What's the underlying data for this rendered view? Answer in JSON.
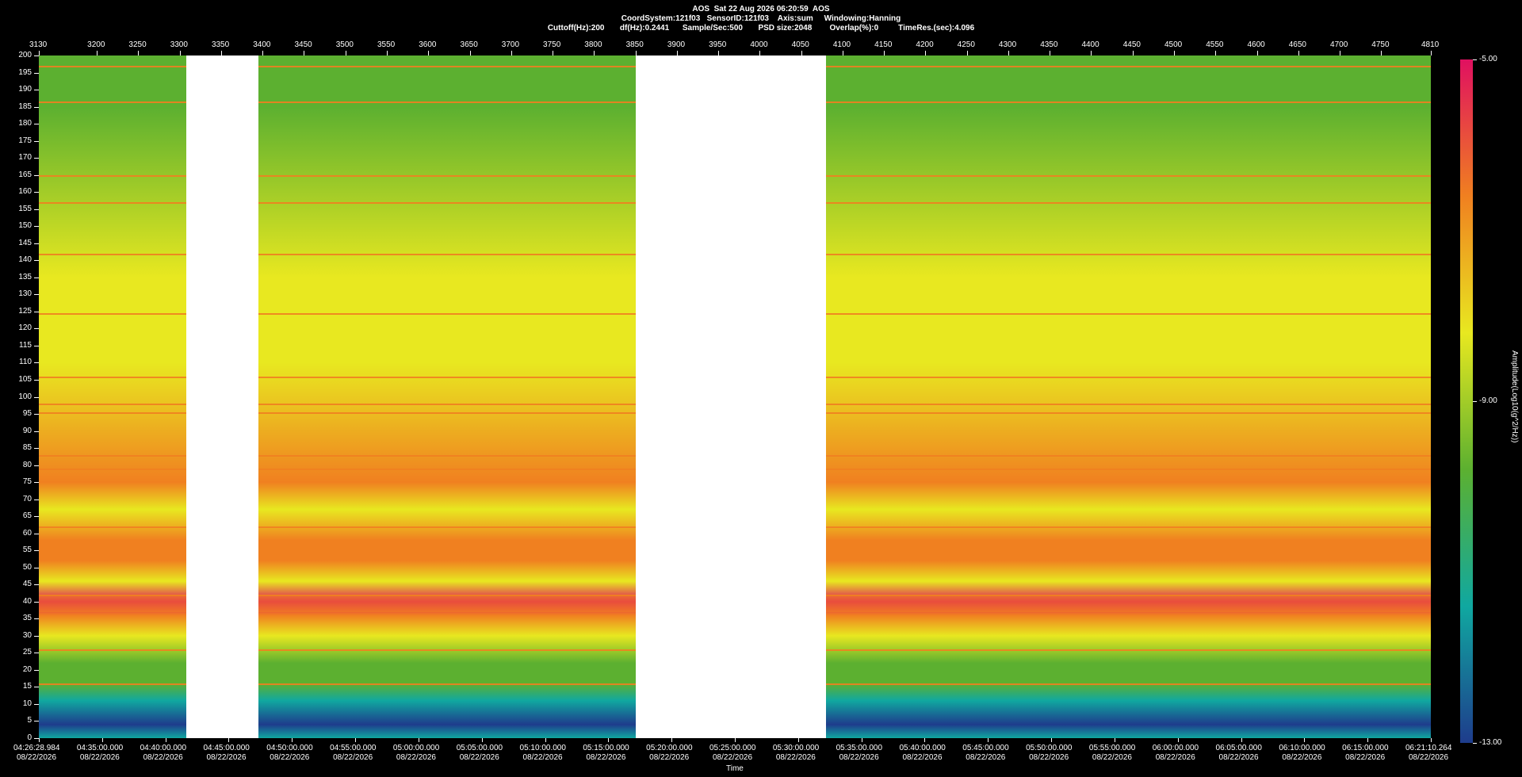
{
  "header": {
    "line1": "AOS  Sat 22 Aug 2026 06:20:59  AOS",
    "line2": "CoordSystem:121f03   SensorID:121f03    Axis:sum     Windowing:Hanning",
    "line3": "Cuttoff(Hz):200       df(Hz):0.2441      Sample/Sec:500       PSD size:2048        Overlap(%):0         TimeRes.(sec):4.096"
  },
  "chart_data": {
    "type": "heatmap",
    "title": "AOS  Sat 22 Aug 2026 06:20:59  AOS",
    "xlabel": "Time",
    "ylabel": "",
    "colorbar_label": "Amplitude(Log10(g^2/Hz))",
    "colorbar_ticks": [
      "-5.00",
      "-9.00",
      "-13.00"
    ],
    "colorbar_range": [
      -13,
      -5
    ],
    "top_axis_ticks": [
      3130,
      3200,
      3250,
      3300,
      3350,
      3400,
      3450,
      3500,
      3550,
      3600,
      3650,
      3700,
      3750,
      3800,
      3850,
      3900,
      3950,
      4000,
      4050,
      4100,
      4150,
      4200,
      4250,
      4300,
      4350,
      4400,
      4450,
      4500,
      4550,
      4600,
      4650,
      4700,
      4750,
      4810
    ],
    "top_axis_range": [
      3130,
      4810
    ],
    "y_ticks": [
      200,
      195,
      190,
      185,
      180,
      175,
      170,
      165,
      160,
      155,
      150,
      145,
      140,
      135,
      130,
      125,
      120,
      115,
      110,
      105,
      100,
      95,
      90,
      85,
      80,
      75,
      70,
      65,
      60,
      55,
      50,
      45,
      40,
      35,
      30,
      25,
      20,
      15,
      10,
      5,
      0
    ],
    "ylim": [
      0,
      200
    ],
    "x_ticks": [
      {
        "time": "04:26:28.984",
        "date": "08/22/2026"
      },
      {
        "time": "04:35:00.000",
        "date": "08/22/2026"
      },
      {
        "time": "04:40:00.000",
        "date": "08/22/2026"
      },
      {
        "time": "04:45:00.000",
        "date": "08/22/2026"
      },
      {
        "time": "04:50:00.000",
        "date": "08/22/2026"
      },
      {
        "time": "04:55:00.000",
        "date": "08/22/2026"
      },
      {
        "time": "05:00:00.000",
        "date": "08/22/2026"
      },
      {
        "time": "05:05:00.000",
        "date": "08/22/2026"
      },
      {
        "time": "05:10:00.000",
        "date": "08/22/2026"
      },
      {
        "time": "05:15:00.000",
        "date": "08/22/2026"
      },
      {
        "time": "05:20:00.000",
        "date": "08/22/2026"
      },
      {
        "time": "05:25:00.000",
        "date": "08/22/2026"
      },
      {
        "time": "05:30:00.000",
        "date": "08/22/2026"
      },
      {
        "time": "05:35:00.000",
        "date": "08/22/2026"
      },
      {
        "time": "05:40:00.000",
        "date": "08/22/2026"
      },
      {
        "time": "05:45:00.000",
        "date": "08/22/2026"
      },
      {
        "time": "05:50:00.000",
        "date": "08/22/2026"
      },
      {
        "time": "05:55:00.000",
        "date": "08/22/2026"
      },
      {
        "time": "06:00:00.000",
        "date": "08/22/2026"
      },
      {
        "time": "06:05:00.000",
        "date": "08/22/2026"
      },
      {
        "time": "06:10:00.000",
        "date": "08/22/2026"
      },
      {
        "time": "06:15:00.000",
        "date": "08/22/2026"
      },
      {
        "time": "06:21:10.264",
        "date": "08/22/2026"
      }
    ],
    "data_gaps_top_axis": [
      [
        3308,
        3395
      ],
      [
        3850,
        4080
      ]
    ],
    "spectral_lines_hz": [
      197,
      186.5,
      165,
      157,
      142,
      124.5,
      106,
      98,
      95.5,
      83,
      79,
      62,
      42,
      26,
      16
    ],
    "broad_bands_hz": [
      [
        37,
        42
      ],
      [
        52,
        58
      ]
    ],
    "colors": {
      "low": "#1e3c8c",
      "mid_low": "#10a8a0",
      "mid": "#5cb030",
      "mid_high": "#e8e820",
      "high": "#f08020",
      "peak": "#e01060"
    }
  }
}
